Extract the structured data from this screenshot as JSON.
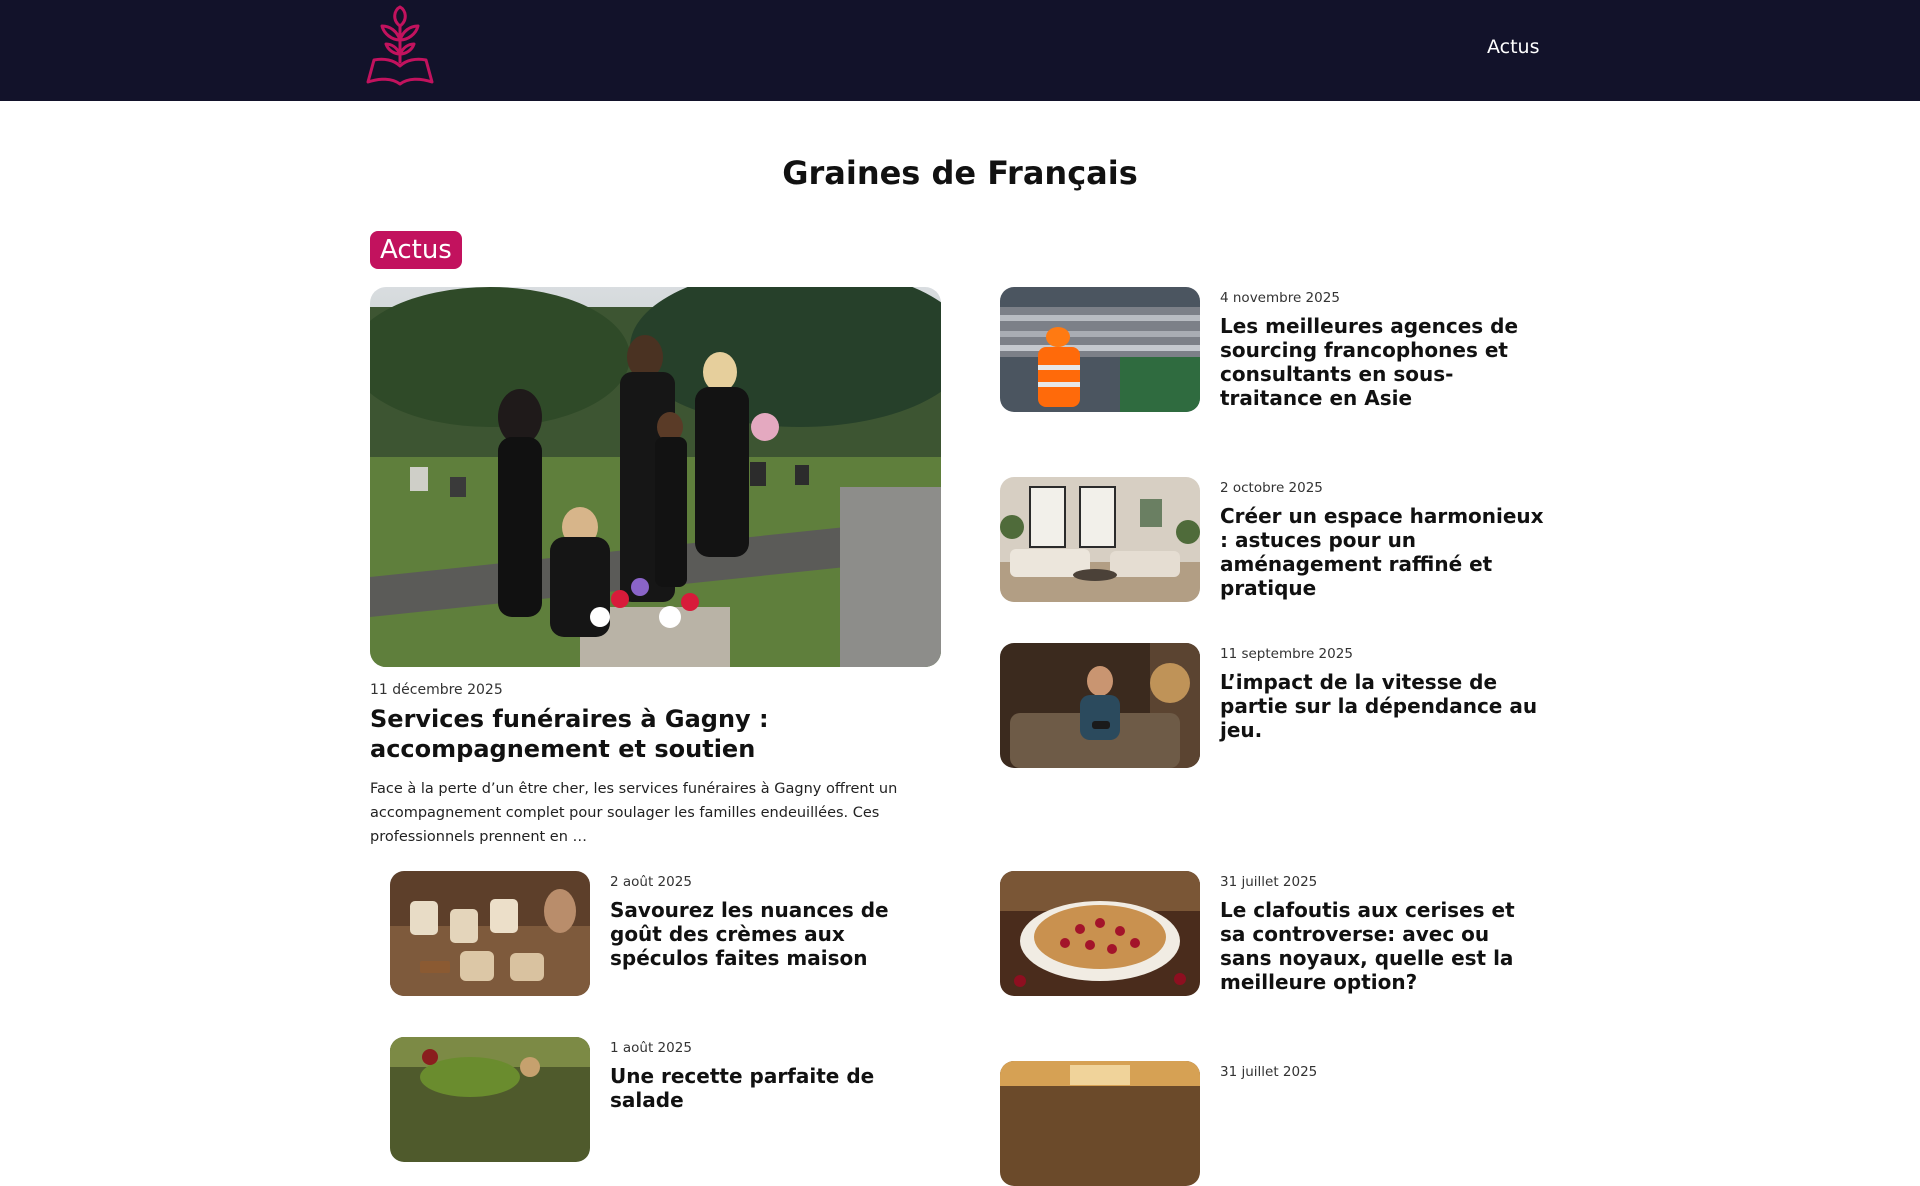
{
  "header": {
    "logo_name": "book-sprout-logo",
    "nav": [
      {
        "label": "Actus"
      }
    ]
  },
  "site": {
    "title": "Graines de Français"
  },
  "category": {
    "label": "Actus"
  },
  "featured": {
    "date": "11 décembre 2025",
    "title": "Services funéraires à Gagny : accompagnement et soutien",
    "excerpt": "Face à la perte d’un être cher, les services funéraires à Gagny offrent un accompagnement complet pour soulager les familles endeuillées. Ces professionnels prennent en …",
    "image": "family-at-cemetery-photo"
  },
  "side_articles": [
    {
      "date": "4 novembre 2025",
      "title": "Les meilleures agences de sourcing francophones et consultants en sous-traitance en Asie",
      "image": "industrial-worker-photo"
    },
    {
      "date": "2 octobre 2025",
      "title": "Créer un espace harmonieux : astuces pour un aménagement raffiné et pratique",
      "image": "living-room-photo"
    },
    {
      "date": "11 septembre 2025",
      "title": "L’impact de la vitesse de partie sur la dépendance au jeu.",
      "image": "gamer-on-sofa-photo"
    }
  ],
  "bottom_articles": [
    {
      "date": "2 août 2025",
      "title": "Savourez les nuances de goût des crèmes aux spéculos faites maison",
      "image": "speculoos-cream-jars-photo"
    },
    {
      "date": "31 juillet 2025",
      "title": "Le clafoutis aux cerises et sa controverse: avec ou sans noyaux, quelle est la meilleure option?",
      "image": "cherry-clafoutis-photo"
    },
    {
      "date": "1 août 2025",
      "title": "Une recette parfaite de salade",
      "image": "salad-table-photo"
    },
    {
      "date": "31 juillet 2025",
      "title": "",
      "image": "kitchen-photo"
    }
  ],
  "colors": {
    "header_bg": "#12122a",
    "accent": "#c2125e",
    "text": "#111111"
  }
}
